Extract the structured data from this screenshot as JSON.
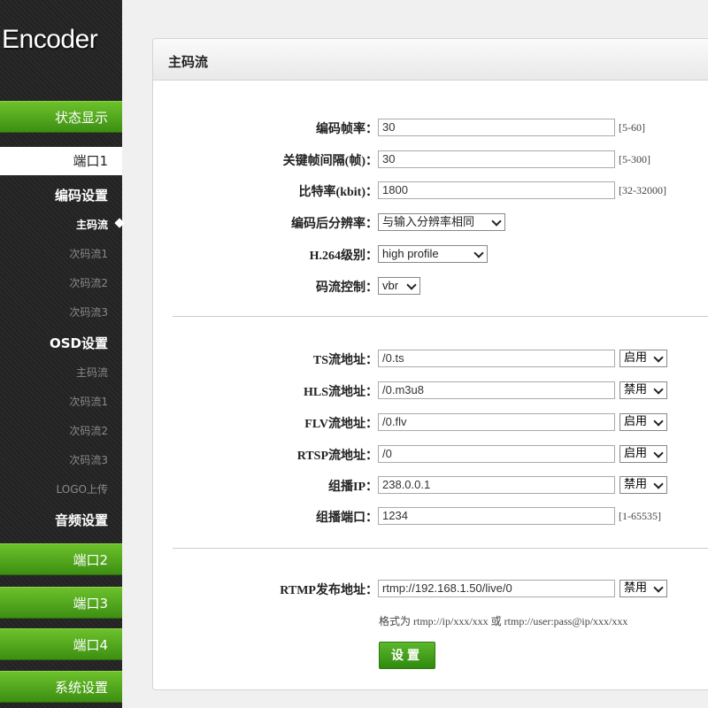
{
  "app": {
    "logo": "Encoder"
  },
  "sidebar": {
    "status": "状态显示",
    "port1": "端口1",
    "encode_settings": "编码设置",
    "encode_items": [
      "主码流",
      "次码流1",
      "次码流2",
      "次码流3"
    ],
    "osd_settings": "OSD设置",
    "osd_items": [
      "主码流",
      "次码流1",
      "次码流2",
      "次码流3",
      "LOGO上传"
    ],
    "audio_settings": "音频设置",
    "port2": "端口2",
    "port3": "端口3",
    "port4": "端口4",
    "system": "系统设置"
  },
  "panel": {
    "title": "主码流",
    "fps_label": "编码帧率：",
    "fps_value": "30",
    "fps_hint": "[5-60]",
    "gop_label": "关键帧间隔(帧)：",
    "gop_value": "30",
    "gop_hint": "[5-300]",
    "bitrate_label": "比特率(kbit)：",
    "bitrate_value": "1800",
    "bitrate_hint": "[32-32000]",
    "res_label": "编码后分辨率：",
    "res_value": "与输入分辨率相同",
    "level_label": "H.264级别：",
    "level_value": "high profile",
    "rc_label": "码流控制：",
    "rc_value": "vbr",
    "ts_label": "TS流地址：",
    "ts_value": "/0.ts",
    "ts_state": "启用",
    "hls_label": "HLS流地址：",
    "hls_value": "/0.m3u8",
    "hls_state": "禁用",
    "flv_label": "FLV流地址：",
    "flv_value": "/0.flv",
    "flv_state": "启用",
    "rtsp_label": "RTSP流地址：",
    "rtsp_value": "/0",
    "rtsp_state": "启用",
    "mc_ip_label": "组播IP：",
    "mc_ip_value": "238.0.0.1",
    "mc_ip_state": "禁用",
    "mc_port_label": "组播端口：",
    "mc_port_value": "1234",
    "mc_port_hint": "[1-65535]",
    "rtmp_label": "RTMP发布地址：",
    "rtmp_value": "rtmp://192.168.1.50/live/0",
    "rtmp_state": "禁用",
    "rtmp_hint": "格式为 rtmp://ip/xxx/xxx 或 rtmp://user:pass@ip/xxx/xxx",
    "set_button": "设置"
  }
}
